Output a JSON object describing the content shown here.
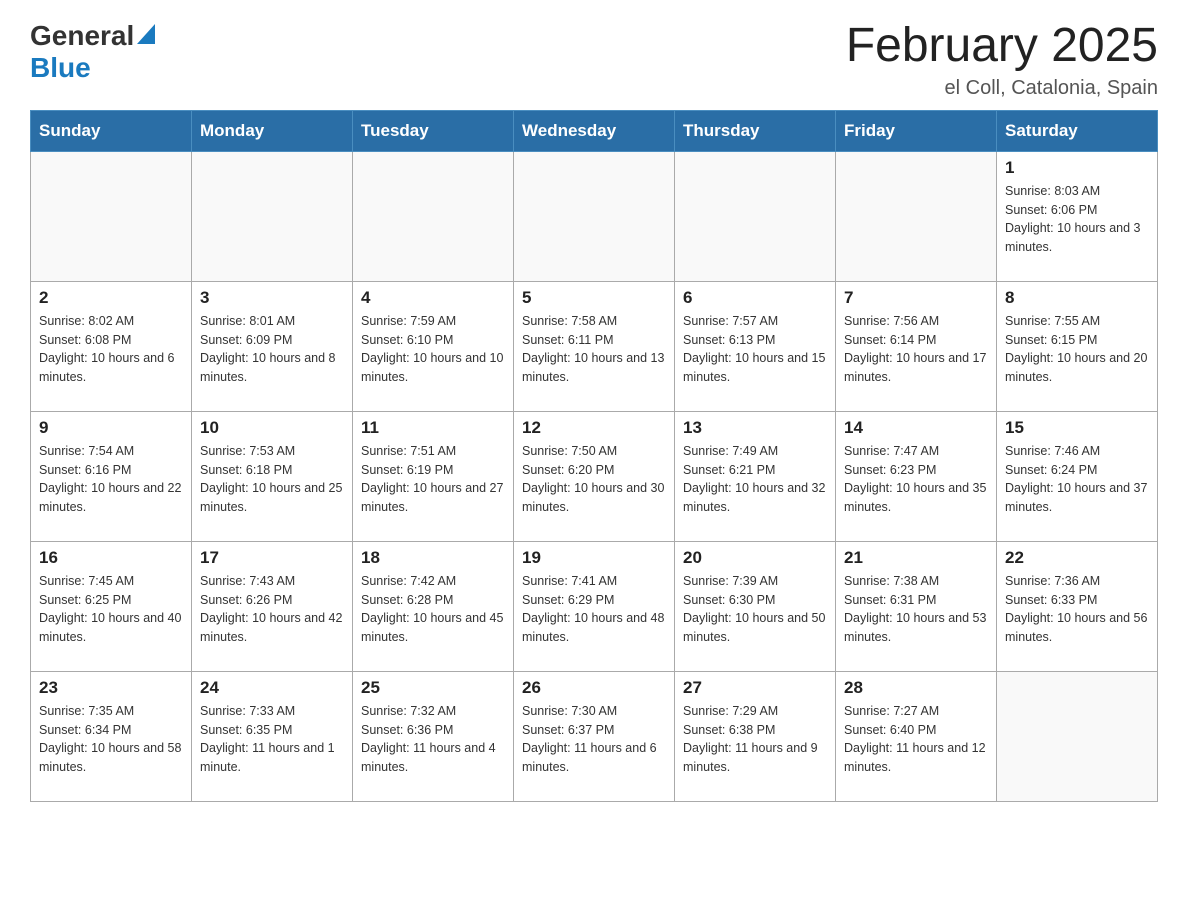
{
  "header": {
    "logo_general": "General",
    "logo_blue": "Blue",
    "title": "February 2025",
    "subtitle": "el Coll, Catalonia, Spain"
  },
  "days_of_week": [
    "Sunday",
    "Monday",
    "Tuesday",
    "Wednesday",
    "Thursday",
    "Friday",
    "Saturday"
  ],
  "weeks": [
    [
      {
        "day": "",
        "info": ""
      },
      {
        "day": "",
        "info": ""
      },
      {
        "day": "",
        "info": ""
      },
      {
        "day": "",
        "info": ""
      },
      {
        "day": "",
        "info": ""
      },
      {
        "day": "",
        "info": ""
      },
      {
        "day": "1",
        "info": "Sunrise: 8:03 AM\nSunset: 6:06 PM\nDaylight: 10 hours and 3 minutes."
      }
    ],
    [
      {
        "day": "2",
        "info": "Sunrise: 8:02 AM\nSunset: 6:08 PM\nDaylight: 10 hours and 6 minutes."
      },
      {
        "day": "3",
        "info": "Sunrise: 8:01 AM\nSunset: 6:09 PM\nDaylight: 10 hours and 8 minutes."
      },
      {
        "day": "4",
        "info": "Sunrise: 7:59 AM\nSunset: 6:10 PM\nDaylight: 10 hours and 10 minutes."
      },
      {
        "day": "5",
        "info": "Sunrise: 7:58 AM\nSunset: 6:11 PM\nDaylight: 10 hours and 13 minutes."
      },
      {
        "day": "6",
        "info": "Sunrise: 7:57 AM\nSunset: 6:13 PM\nDaylight: 10 hours and 15 minutes."
      },
      {
        "day": "7",
        "info": "Sunrise: 7:56 AM\nSunset: 6:14 PM\nDaylight: 10 hours and 17 minutes."
      },
      {
        "day": "8",
        "info": "Sunrise: 7:55 AM\nSunset: 6:15 PM\nDaylight: 10 hours and 20 minutes."
      }
    ],
    [
      {
        "day": "9",
        "info": "Sunrise: 7:54 AM\nSunset: 6:16 PM\nDaylight: 10 hours and 22 minutes."
      },
      {
        "day": "10",
        "info": "Sunrise: 7:53 AM\nSunset: 6:18 PM\nDaylight: 10 hours and 25 minutes."
      },
      {
        "day": "11",
        "info": "Sunrise: 7:51 AM\nSunset: 6:19 PM\nDaylight: 10 hours and 27 minutes."
      },
      {
        "day": "12",
        "info": "Sunrise: 7:50 AM\nSunset: 6:20 PM\nDaylight: 10 hours and 30 minutes."
      },
      {
        "day": "13",
        "info": "Sunrise: 7:49 AM\nSunset: 6:21 PM\nDaylight: 10 hours and 32 minutes."
      },
      {
        "day": "14",
        "info": "Sunrise: 7:47 AM\nSunset: 6:23 PM\nDaylight: 10 hours and 35 minutes."
      },
      {
        "day": "15",
        "info": "Sunrise: 7:46 AM\nSunset: 6:24 PM\nDaylight: 10 hours and 37 minutes."
      }
    ],
    [
      {
        "day": "16",
        "info": "Sunrise: 7:45 AM\nSunset: 6:25 PM\nDaylight: 10 hours and 40 minutes."
      },
      {
        "day": "17",
        "info": "Sunrise: 7:43 AM\nSunset: 6:26 PM\nDaylight: 10 hours and 42 minutes."
      },
      {
        "day": "18",
        "info": "Sunrise: 7:42 AM\nSunset: 6:28 PM\nDaylight: 10 hours and 45 minutes."
      },
      {
        "day": "19",
        "info": "Sunrise: 7:41 AM\nSunset: 6:29 PM\nDaylight: 10 hours and 48 minutes."
      },
      {
        "day": "20",
        "info": "Sunrise: 7:39 AM\nSunset: 6:30 PM\nDaylight: 10 hours and 50 minutes."
      },
      {
        "day": "21",
        "info": "Sunrise: 7:38 AM\nSunset: 6:31 PM\nDaylight: 10 hours and 53 minutes."
      },
      {
        "day": "22",
        "info": "Sunrise: 7:36 AM\nSunset: 6:33 PM\nDaylight: 10 hours and 56 minutes."
      }
    ],
    [
      {
        "day": "23",
        "info": "Sunrise: 7:35 AM\nSunset: 6:34 PM\nDaylight: 10 hours and 58 minutes."
      },
      {
        "day": "24",
        "info": "Sunrise: 7:33 AM\nSunset: 6:35 PM\nDaylight: 11 hours and 1 minute."
      },
      {
        "day": "25",
        "info": "Sunrise: 7:32 AM\nSunset: 6:36 PM\nDaylight: 11 hours and 4 minutes."
      },
      {
        "day": "26",
        "info": "Sunrise: 7:30 AM\nSunset: 6:37 PM\nDaylight: 11 hours and 6 minutes."
      },
      {
        "day": "27",
        "info": "Sunrise: 7:29 AM\nSunset: 6:38 PM\nDaylight: 11 hours and 9 minutes."
      },
      {
        "day": "28",
        "info": "Sunrise: 7:27 AM\nSunset: 6:40 PM\nDaylight: 11 hours and 12 minutes."
      },
      {
        "day": "",
        "info": ""
      }
    ]
  ]
}
